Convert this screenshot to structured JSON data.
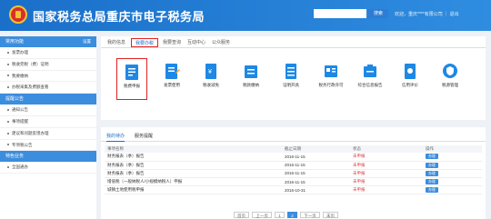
{
  "header": {
    "title": "国家税务总局重庆市电子税务局",
    "search_button": "搜索",
    "user_text": "欢迎，重庆****有限公司 ｜ 退出"
  },
  "sidebar": {
    "sections": [
      {
        "title": "常用功能",
        "action": "设置",
        "items": [
          "发票办理",
          "税收完税（费）证明",
          "我要缴纳",
          "办税采集及费额查看"
        ]
      },
      {
        "title": "提醒公告",
        "action": "",
        "items": [
          "通知公告",
          "事项提醒",
          "建议和问题反馈办理",
          "专项税公告"
        ]
      },
      {
        "title": "特色业务",
        "action": "",
        "items": [
          "全国通办"
        ]
      }
    ]
  },
  "tabs": [
    "我的信息",
    "我要办税",
    "我要查询",
    "互动中心",
    "公众服务"
  ],
  "active_tab_index": 1,
  "icons": [
    {
      "label": "税费申报",
      "icon": "tax-declaration-icon",
      "color": "#1e88e5"
    },
    {
      "label": "发票使用",
      "icon": "invoice-use-icon",
      "color": "#1e88e5"
    },
    {
      "label": "税收减免",
      "icon": "tax-relief-icon",
      "color": "#1e88e5"
    },
    {
      "label": "税款缴纳",
      "icon": "tax-payment-icon",
      "color": "#1e88e5"
    },
    {
      "label": "证明开具",
      "icon": "certificate-icon",
      "color": "#1e88e5"
    },
    {
      "label": "税务行政许可",
      "icon": "permit-icon",
      "color": "#1e88e5"
    },
    {
      "label": "综合信息报告",
      "icon": "report-icon",
      "color": "#1e88e5"
    },
    {
      "label": "信用评价",
      "icon": "credit-icon",
      "color": "#1e88e5"
    },
    {
      "label": "税源管理",
      "icon": "shield-icon",
      "color": "#1e88e5"
    }
  ],
  "bottom_tabs": [
    "我的待办",
    "服务提醒"
  ],
  "table": {
    "headers": [
      "事项名称",
      "截止日期",
      "状态",
      "操作"
    ],
    "rows": [
      {
        "name": "财务报表（季）报告",
        "date": "2016-11-15",
        "status": "未申报",
        "action": "办理"
      },
      {
        "name": "财务报表（季）报告",
        "date": "2016-11-15",
        "status": "未申报",
        "action": "办理"
      },
      {
        "name": "财务报表（季）报告",
        "date": "2016-11-15",
        "status": "未申报",
        "action": "办理"
      },
      {
        "name": "增值税（一般纳税人/小规模纳税人）申报",
        "date": "2016-11-15",
        "status": "未申报",
        "action": "办理"
      },
      {
        "name": "城镇土地使用税申报",
        "date": "2016-10-31",
        "status": "未申报",
        "action": "办理"
      }
    ]
  },
  "pager": {
    "first": "首页",
    "prev": "上一页",
    "pages": [
      "1",
      "2"
    ],
    "next": "下一页",
    "last": "末页"
  },
  "colors": {
    "header": "#1a6fc9",
    "accent": "#3b8ddd",
    "highlight": "#e02020"
  }
}
